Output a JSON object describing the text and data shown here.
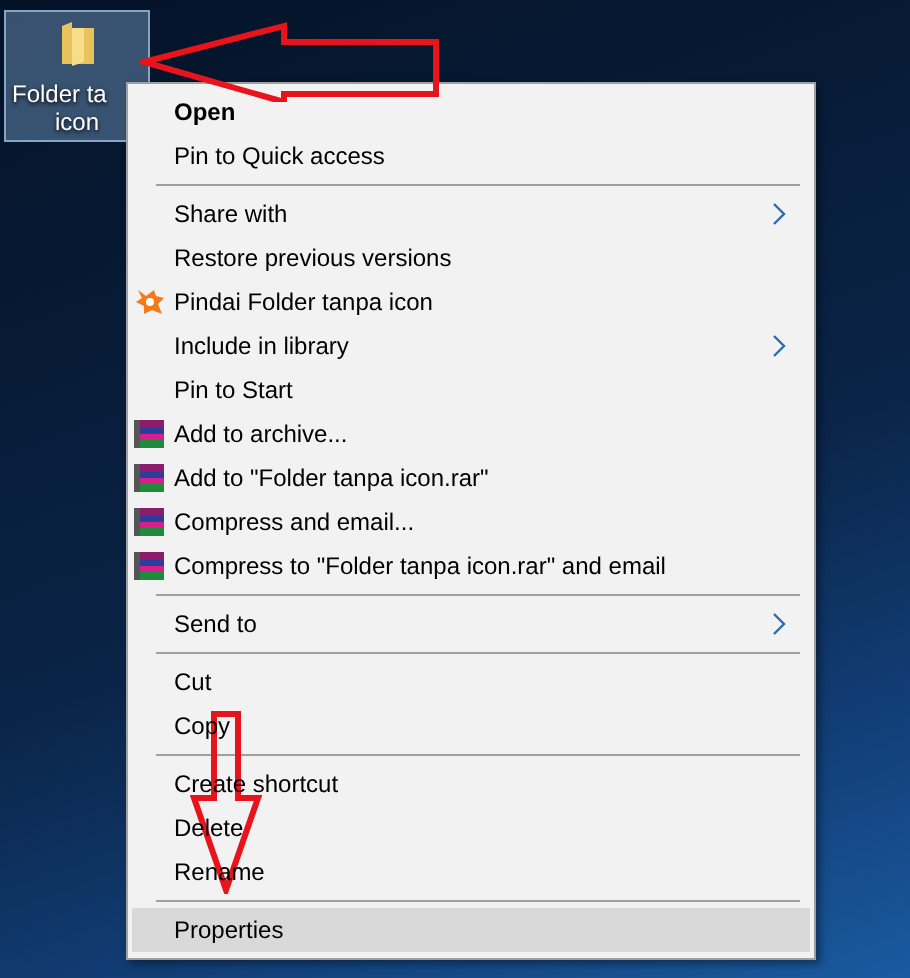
{
  "desktop_icon": {
    "label_lines": [
      "Folder ta",
      "icon"
    ],
    "selected": true
  },
  "context_menu": {
    "items": [
      {
        "kind": "item",
        "label": "Open",
        "default": true,
        "submenu": false,
        "selected": false
      },
      {
        "kind": "item",
        "label": "Pin to Quick access",
        "submenu": false,
        "selected": false
      },
      {
        "kind": "separator"
      },
      {
        "kind": "item",
        "label": "Share with",
        "submenu": true,
        "selected": false
      },
      {
        "kind": "item",
        "label": "Restore previous versions",
        "submenu": false,
        "selected": false
      },
      {
        "kind": "scan",
        "label": "Pindai Folder tanpa icon",
        "submenu": false,
        "selected": false
      },
      {
        "kind": "item",
        "label": "Include in library",
        "submenu": true,
        "selected": false
      },
      {
        "kind": "item",
        "label": "Pin to Start",
        "submenu": false,
        "selected": false
      },
      {
        "kind": "archive",
        "label": "Add to archive...",
        "submenu": false,
        "selected": false
      },
      {
        "kind": "archive",
        "label": "Add to \"Folder tanpa icon.rar\"",
        "submenu": false,
        "selected": false
      },
      {
        "kind": "archive",
        "label": "Compress and email...",
        "submenu": false,
        "selected": false
      },
      {
        "kind": "archive",
        "label": "Compress to \"Folder tanpa icon.rar\" and email",
        "submenu": false,
        "selected": false
      },
      {
        "kind": "separator"
      },
      {
        "kind": "item",
        "label": "Send to",
        "submenu": true,
        "selected": false
      },
      {
        "kind": "separator"
      },
      {
        "kind": "item",
        "label": "Cut",
        "submenu": false,
        "selected": false
      },
      {
        "kind": "item",
        "label": "Copy",
        "submenu": false,
        "selected": false
      },
      {
        "kind": "separator"
      },
      {
        "kind": "item",
        "label": "Create shortcut",
        "submenu": false,
        "selected": false
      },
      {
        "kind": "item",
        "label": "Delete",
        "submenu": false,
        "selected": false
      },
      {
        "kind": "item",
        "label": "Rename",
        "submenu": false,
        "selected": false
      },
      {
        "kind": "separator"
      },
      {
        "kind": "item",
        "label": "Properties",
        "submenu": false,
        "selected": true
      }
    ]
  }
}
